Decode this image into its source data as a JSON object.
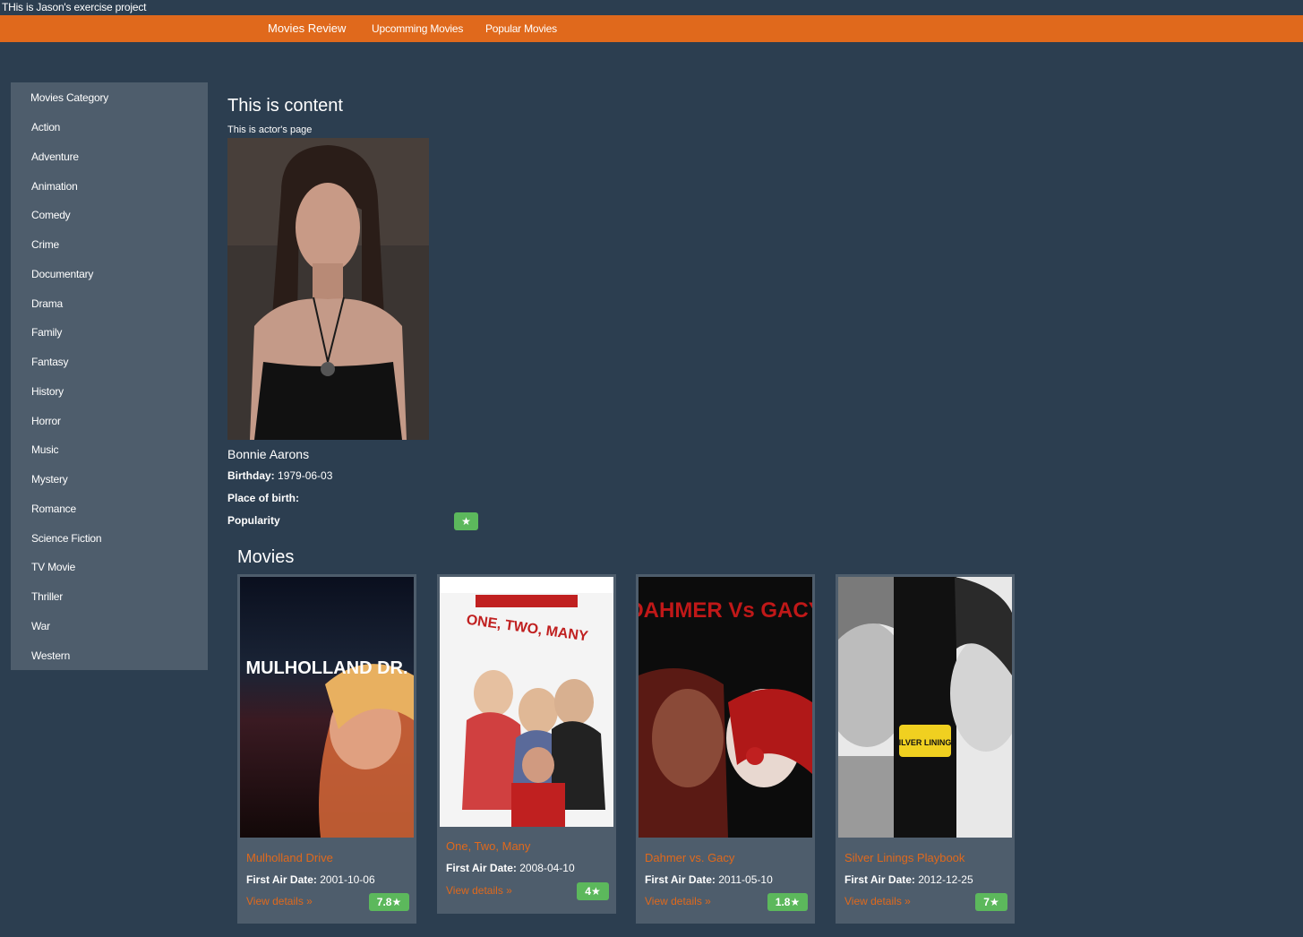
{
  "top_text": "THis is Jason's exercise project",
  "navbar": {
    "brand": "Movies Review",
    "links": [
      "Upcomming Movies",
      "Popular Movies"
    ]
  },
  "sidebar": {
    "title": "Movies Category",
    "items": [
      "Action",
      "Adventure",
      "Animation",
      "Comedy",
      "Crime",
      "Documentary",
      "Drama",
      "Family",
      "Fantasy",
      "History",
      "Horror",
      "Music",
      "Mystery",
      "Romance",
      "Science Fiction",
      "TV Movie",
      "Thriller",
      "War",
      "Western"
    ]
  },
  "content": {
    "title": "This is content",
    "subtitle": "This is actor's page"
  },
  "actor": {
    "name": "Bonnie Aarons",
    "birthday_label": "Birthday:",
    "birthday": "1979-06-03",
    "place_label": "Place of birth:",
    "place": "",
    "popularity_label": "Popularity",
    "popularity_badge": "★"
  },
  "movies": {
    "title": "Movies",
    "date_label": "First Air Date:",
    "link_label": "View details »",
    "items": [
      {
        "title": "Mulholland Drive",
        "date": "2001-10-06",
        "rating": "7.8★",
        "poster_text": "MULHOLLAND DR."
      },
      {
        "title": "One, Two, Many",
        "date": "2008-04-10",
        "rating": "4★",
        "poster_text": "ONE, TWO, MANY"
      },
      {
        "title": "Dahmer vs. Gacy",
        "date": "2011-05-10",
        "rating": "1.8★",
        "poster_text": "DAHMER Vs GACY"
      },
      {
        "title": "Silver Linings Playbook",
        "date": "2012-12-25",
        "rating": "7★",
        "poster_text": "SILVER LININGS"
      }
    ]
  },
  "colors": {
    "background": "#2c3e50",
    "navbar": "#e0691c",
    "panel": "#4e5d6c",
    "badge": "#5cb85c",
    "link": "#e0691c"
  }
}
